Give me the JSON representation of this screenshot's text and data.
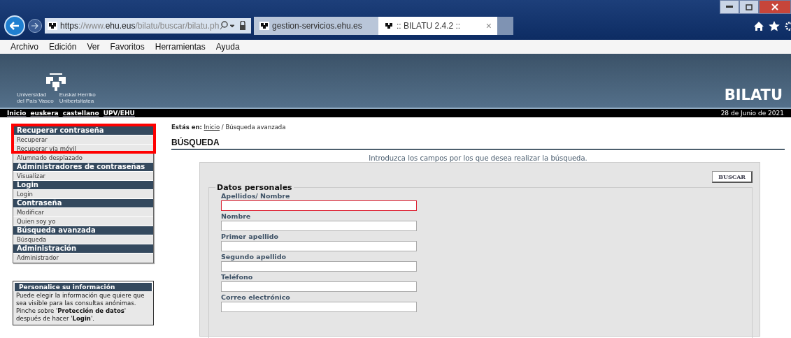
{
  "browser": {
    "url": {
      "prefix": "https://www.",
      "domain": "ehu.eus",
      "path": "/bilatu/buscar/bilatu.ph"
    },
    "tabs": [
      {
        "title": "gestion-servicios.ehu.es",
        "selected": false
      },
      {
        "title": ":: BILATU 2.4.2 ::",
        "selected": true,
        "close": "×"
      }
    ],
    "menu": [
      "Archivo",
      "Edición",
      "Ver",
      "Favoritos",
      "Herramientas",
      "Ayuda"
    ]
  },
  "header": {
    "logo_text": [
      "Universidad\ndel País Vasco",
      "Euskal Herriko\nUnibertsitatea"
    ],
    "title": "BILATU"
  },
  "nav": {
    "links": [
      "Inicio",
      "euskera",
      "castellano",
      "UPV/EHU"
    ],
    "date": "28 de Junio de 2021"
  },
  "sidebar": {
    "sections": [
      {
        "title": "Recuperar contraseña",
        "highlighted": true,
        "items": [
          "Recuperar",
          "Recuperar vía móvil"
        ]
      },
      {
        "items": [
          "Alumnado desplazado"
        ]
      },
      {
        "title": "Administradores de contraseñas",
        "items": [
          "Visualizar"
        ]
      },
      {
        "title": "Login",
        "items": [
          "Login"
        ]
      },
      {
        "title": "Contraseña",
        "items": [
          "Modificar",
          "Quien soy yo"
        ]
      },
      {
        "title": "Búsqueda avanzada",
        "items": [
          "Búsqueda"
        ]
      },
      {
        "title": "Administración",
        "items": [
          "Administrador"
        ]
      }
    ],
    "info": {
      "title": "Personalice su información",
      "text": "Puede elegir la información que quiere que sea visible para las consultas anónimas. Pinche sobre '**Protección de datos**' después de hacer '**Login**'."
    }
  },
  "breadcrumb": {
    "label": "Estás en:",
    "link": "Inicio",
    "current": "/ Búsqueda avanzada"
  },
  "heading": "BÚSQUEDA",
  "intro": "Introduzca los campos por los que desea realizar la búsqueda.",
  "search_button": "BUSCAR",
  "fieldset": {
    "legend": "Datos personales",
    "fields": [
      {
        "label": "Apellidos/ Nombre",
        "focused": true
      },
      {
        "label": "Nombre",
        "focused": false
      },
      {
        "label": "Primer apellido",
        "focused": false
      },
      {
        "label": "Segundo apellido",
        "focused": false
      },
      {
        "label": "Teléfono",
        "focused": false
      },
      {
        "label": "Correo electrónico",
        "focused": false
      }
    ]
  }
}
